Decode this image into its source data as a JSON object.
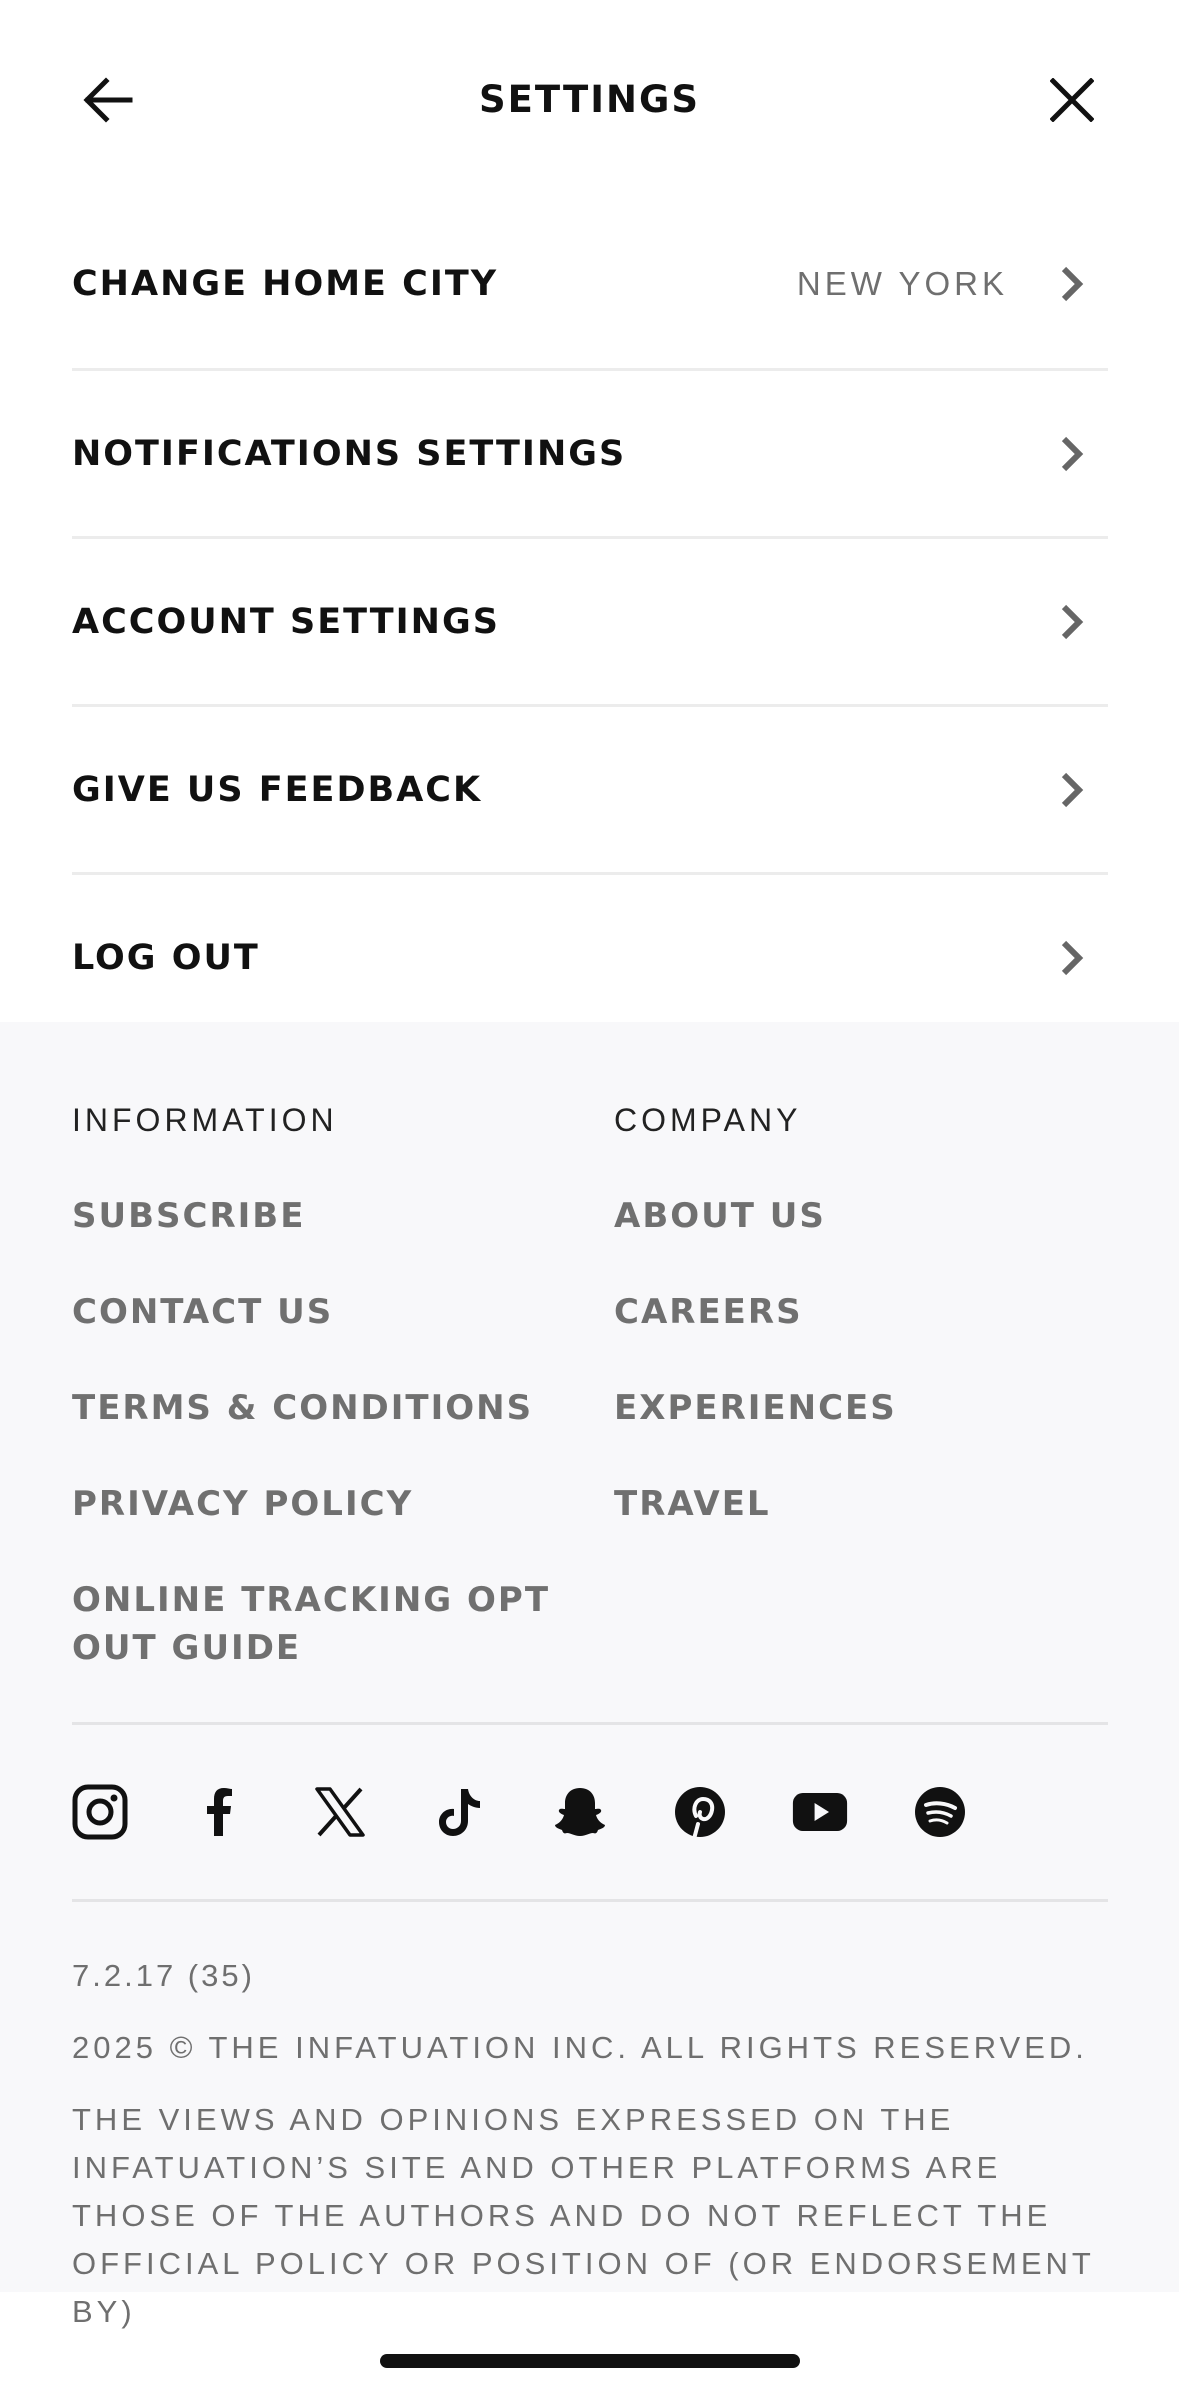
{
  "header": {
    "title": "SETTINGS",
    "back_icon": "arrow-left-icon",
    "close_icon": "close-icon"
  },
  "menu": {
    "items": [
      {
        "label": "CHANGE HOME CITY",
        "value": "NEW YORK"
      },
      {
        "label": "NOTIFICATIONS SETTINGS"
      },
      {
        "label": "ACCOUNT SETTINGS"
      },
      {
        "label": "GIVE US FEEDBACK"
      },
      {
        "label": "LOG OUT"
      }
    ]
  },
  "footer": {
    "information": {
      "heading": "INFORMATION",
      "links": [
        "SUBSCRIBE",
        "CONTACT US",
        "TERMS & CONDITIONS",
        "PRIVACY POLICY",
        "ONLINE TRACKING OPT OUT GUIDE"
      ]
    },
    "company": {
      "heading": "COMPANY",
      "links": [
        "ABOUT US",
        "CAREERS",
        "EXPERIENCES",
        "TRAVEL"
      ]
    },
    "social_icons": [
      "instagram-icon",
      "facebook-icon",
      "x-icon",
      "tiktok-icon",
      "snapchat-icon",
      "pinterest-icon",
      "youtube-icon",
      "spotify-icon"
    ],
    "version": "7.2.17 (35)",
    "copyright": "2025 © THE INFATUATION INC. ALL RIGHTS RESERVED.",
    "disclaimer": "THE VIEWS AND OPINIONS EXPRESSED ON THE INFATUATION’S SITE AND OTHER PLATFORMS ARE THOSE OF THE AUTHORS AND DO NOT REFLECT THE OFFICIAL POLICY OR POSITION OF (OR ENDORSEMENT BY)"
  },
  "colors": {
    "text": "#111111",
    "muted": "#707070",
    "footer_bg": "#f8f8fa",
    "divider": "#ececec"
  }
}
